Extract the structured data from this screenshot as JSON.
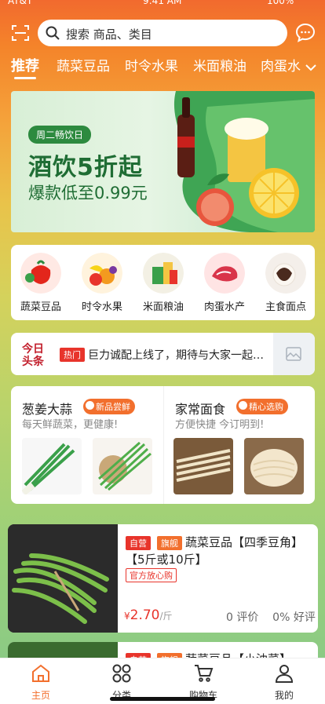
{
  "status_bar": {
    "carrier": "AT&T",
    "time": "9:41 AM",
    "battery": "100%"
  },
  "search": {
    "placeholder": "搜索 商品、类目"
  },
  "tabs": [
    {
      "label": "推荐",
      "active": true
    },
    {
      "label": "蔬菜豆品"
    },
    {
      "label": "时令水果"
    },
    {
      "label": "米面粮油"
    },
    {
      "label": "肉蛋水"
    }
  ],
  "banner": {
    "tag": "周二畅饮日",
    "title": "酒饮5折起",
    "subtitle": "爆款低至0.99元"
  },
  "categories": [
    {
      "label": "蔬菜豆品"
    },
    {
      "label": "时令水果"
    },
    {
      "label": "米面粮油"
    },
    {
      "label": "肉蛋水产"
    },
    {
      "label": "主食面点"
    }
  ],
  "news": {
    "hot_tag": "热门",
    "text": "巨力诚配上线了，期待与大家一起…"
  },
  "promos": [
    {
      "title": "葱姜大蒜",
      "badge": "新品尝鲜",
      "subtitle": "每天鲜蔬菜，更健康!"
    },
    {
      "title": "家常面食",
      "badge": "精心选购",
      "subtitle": "方便快捷 今订明到!"
    }
  ],
  "product": {
    "tag_self": "自营",
    "tag_flag": "旗舰",
    "title_line1": "蔬菜豆品【四季豆角】",
    "title_line2": "【5斤或10斤】",
    "official_tag": "官方放心购",
    "price_symbol": "¥",
    "price": "2.70",
    "unit": "/斤",
    "reviews": "0 评价",
    "good_rate": "0% 好评"
  },
  "product2": {
    "tag_self": "自营",
    "tag_flag": "旗舰",
    "title": "蔬菜豆品【小油菜】"
  },
  "tabbar": [
    {
      "label": "主页",
      "active": true
    },
    {
      "label": "分类"
    },
    {
      "label": "购物车"
    },
    {
      "label": "我的"
    }
  ],
  "colors": {
    "accent": "#f26f2d",
    "price_red": "#e8342b",
    "banner_green": "#1f6d34"
  }
}
